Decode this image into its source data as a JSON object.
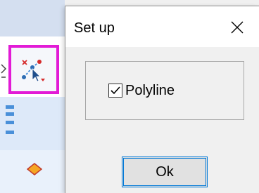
{
  "dialog": {
    "title": "Set up",
    "close_icon": "close-icon",
    "group": {
      "checkbox": {
        "label": "Polyline",
        "checked": true
      }
    },
    "ok_label": "Ok"
  },
  "toolbar": {
    "highlighted_tool_icon": "polyline-select-tool-icon",
    "highlight_color": "#e21bd6"
  },
  "colors": {
    "accent": "#0078d7",
    "dialog_bg": "#f0f0f0",
    "app_band": "#dde9f9",
    "shape_fill": "#f5a623"
  }
}
